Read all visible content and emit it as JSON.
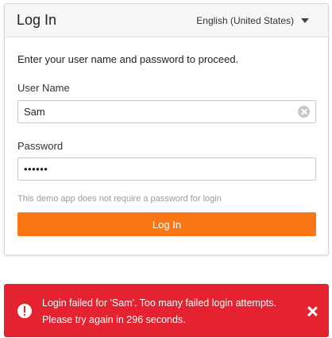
{
  "header": {
    "title": "Log In",
    "language": "English (United States)"
  },
  "form": {
    "intro": "Enter your user name and password to proceed.",
    "username_label": "User Name",
    "username_value": "Sam",
    "password_label": "Password",
    "password_display": "••••••",
    "hint": "This demo app does not require a password for login",
    "submit_label": "Log In"
  },
  "toast": {
    "message": "Login failed for 'Sam'. Too many failed login attempts. Please try again in 296 seconds.",
    "type": "error"
  },
  "colors": {
    "accent": "#fb7716",
    "error": "#e52330"
  },
  "icons": {
    "clear": "clear-icon",
    "alert": "alert-circle-icon",
    "close": "close-icon",
    "dropdown": "chevron-down-icon"
  }
}
